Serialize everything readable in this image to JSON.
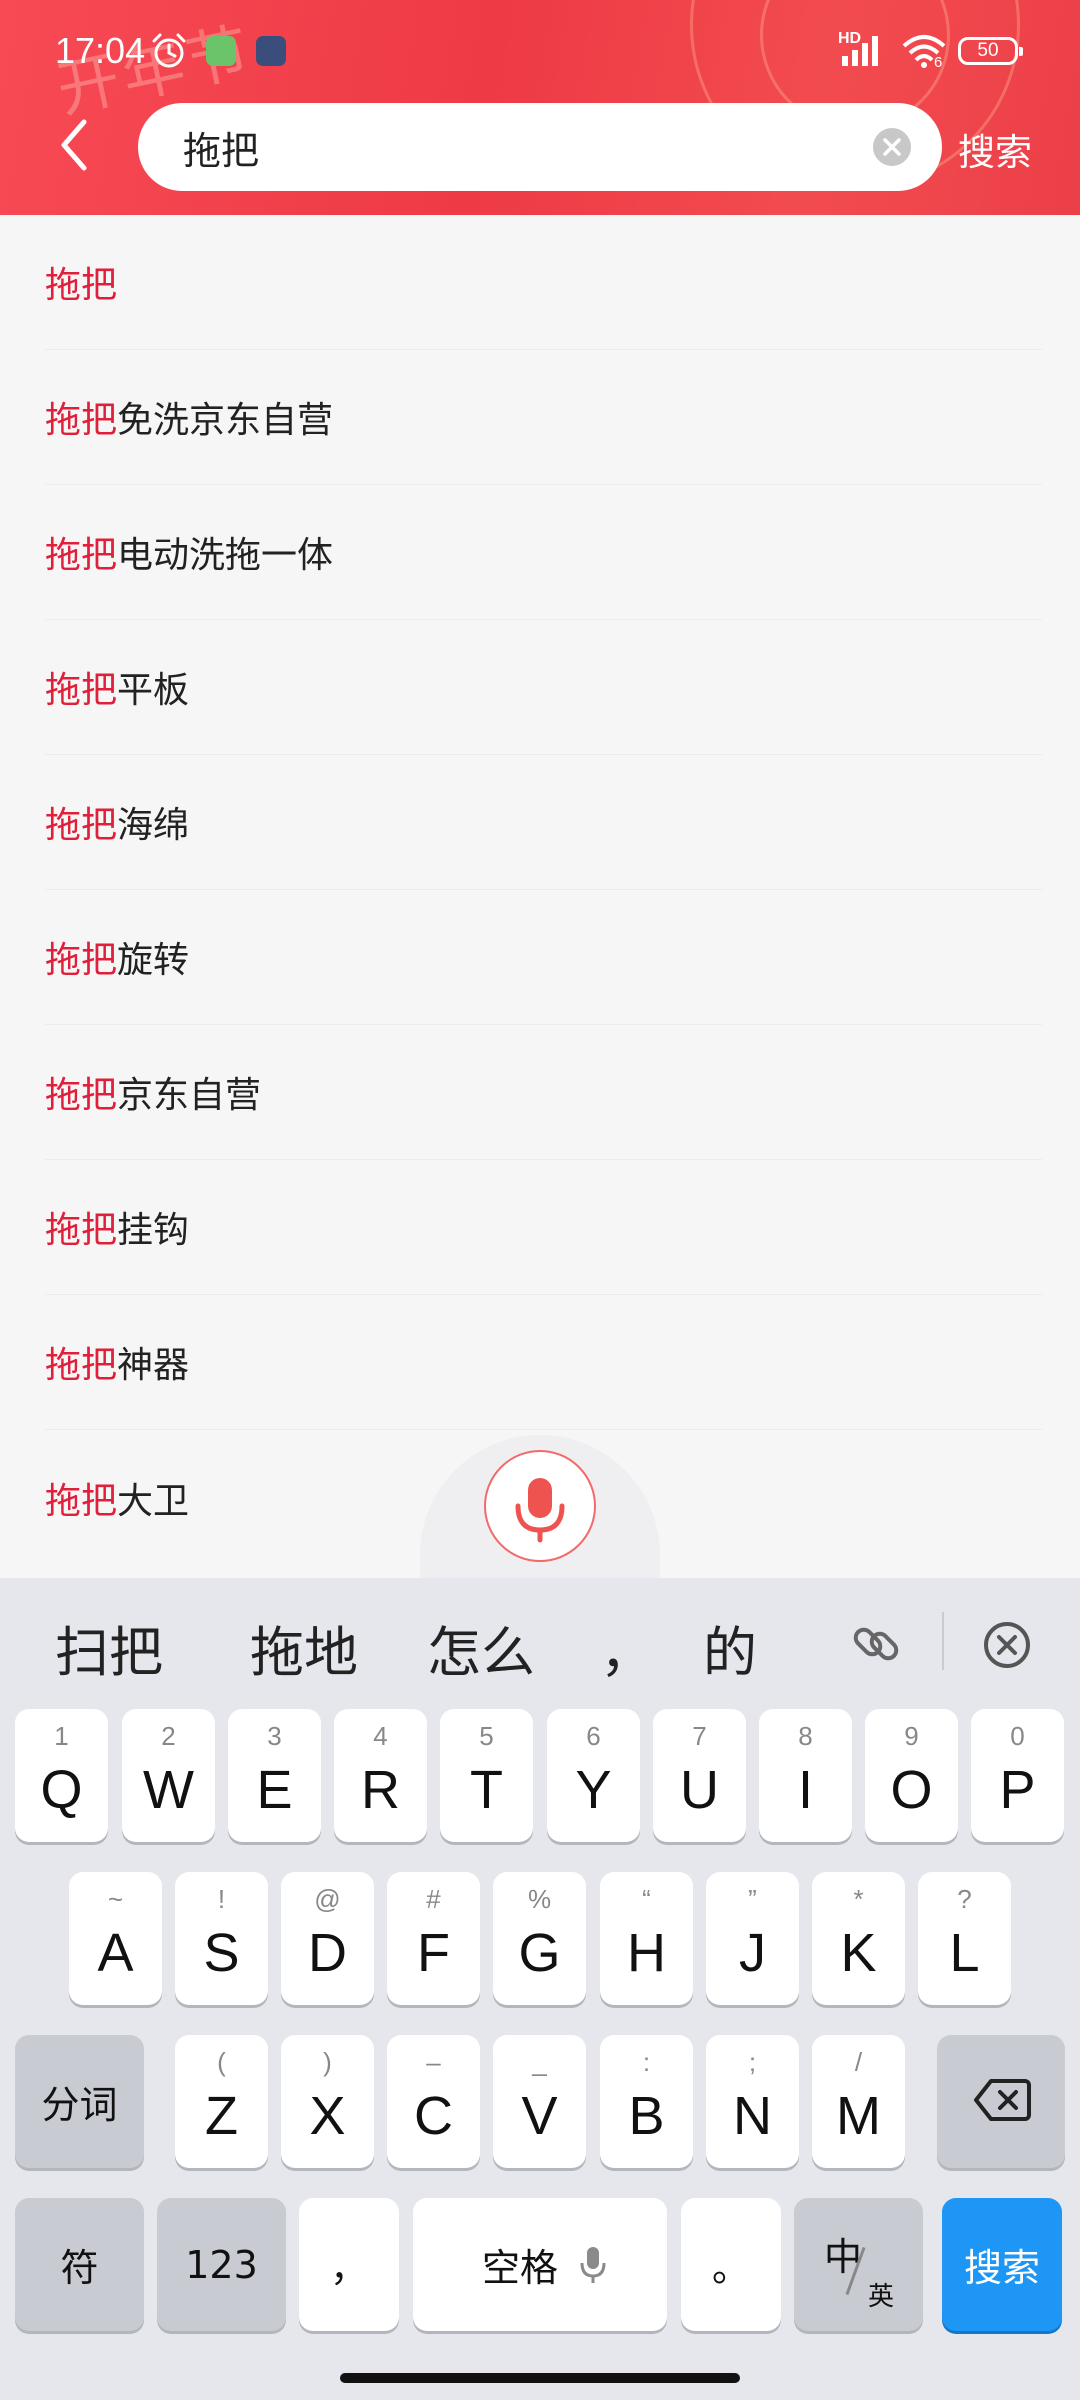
{
  "status_bar": {
    "time": "17:04",
    "network": "HD",
    "wifi_badge": "6",
    "battery": "50"
  },
  "header_decoration_text": "开年节",
  "search": {
    "query": "拖把",
    "submit_label": "搜索"
  },
  "colors": {
    "highlight": "#e0203b",
    "header_red": "#ee3a45",
    "key_blue": "#1e96f5"
  },
  "suggestions": [
    {
      "highlight": "拖把",
      "rest": ""
    },
    {
      "highlight": "拖把",
      "rest": "免洗京东自营"
    },
    {
      "highlight": "拖把",
      "rest": "电动洗拖一体"
    },
    {
      "highlight": "拖把",
      "rest": "平板"
    },
    {
      "highlight": "拖把",
      "rest": "海绵"
    },
    {
      "highlight": "拖把",
      "rest": "旋转"
    },
    {
      "highlight": "拖把",
      "rest": "京东自营"
    },
    {
      "highlight": "拖把",
      "rest": "挂钩"
    },
    {
      "highlight": "拖把",
      "rest": "神器"
    },
    {
      "highlight": "拖把",
      "rest": "大卫"
    }
  ],
  "keyboard": {
    "candidates": [
      "扫把",
      "拖地",
      "怎么",
      "，",
      "的"
    ],
    "row1": [
      {
        "main": "Q",
        "sub": "1"
      },
      {
        "main": "W",
        "sub": "2"
      },
      {
        "main": "E",
        "sub": "3"
      },
      {
        "main": "R",
        "sub": "4"
      },
      {
        "main": "T",
        "sub": "5"
      },
      {
        "main": "Y",
        "sub": "6"
      },
      {
        "main": "U",
        "sub": "7"
      },
      {
        "main": "I",
        "sub": "8"
      },
      {
        "main": "O",
        "sub": "9"
      },
      {
        "main": "P",
        "sub": "0"
      }
    ],
    "row2": [
      {
        "main": "A",
        "sub": "~"
      },
      {
        "main": "S",
        "sub": "!"
      },
      {
        "main": "D",
        "sub": "@"
      },
      {
        "main": "F",
        "sub": "#"
      },
      {
        "main": "G",
        "sub": "%"
      },
      {
        "main": "H",
        "sub": "“"
      },
      {
        "main": "J",
        "sub": "”"
      },
      {
        "main": "K",
        "sub": "*"
      },
      {
        "main": "L",
        "sub": "?"
      }
    ],
    "row3": [
      {
        "main": "Z",
        "sub": "("
      },
      {
        "main": "X",
        "sub": ")"
      },
      {
        "main": "C",
        "sub": "–"
      },
      {
        "main": "V",
        "sub": "_"
      },
      {
        "main": "B",
        "sub": ":"
      },
      {
        "main": "N",
        "sub": ";"
      },
      {
        "main": "M",
        "sub": "/"
      }
    ],
    "segment_label": "分词",
    "symbols_label": "符",
    "numbers_label": "123",
    "comma_label": "，",
    "space_label": "空格",
    "period_label": "。",
    "lang_main": "中",
    "lang_sub": "英",
    "search_label": "搜索"
  }
}
